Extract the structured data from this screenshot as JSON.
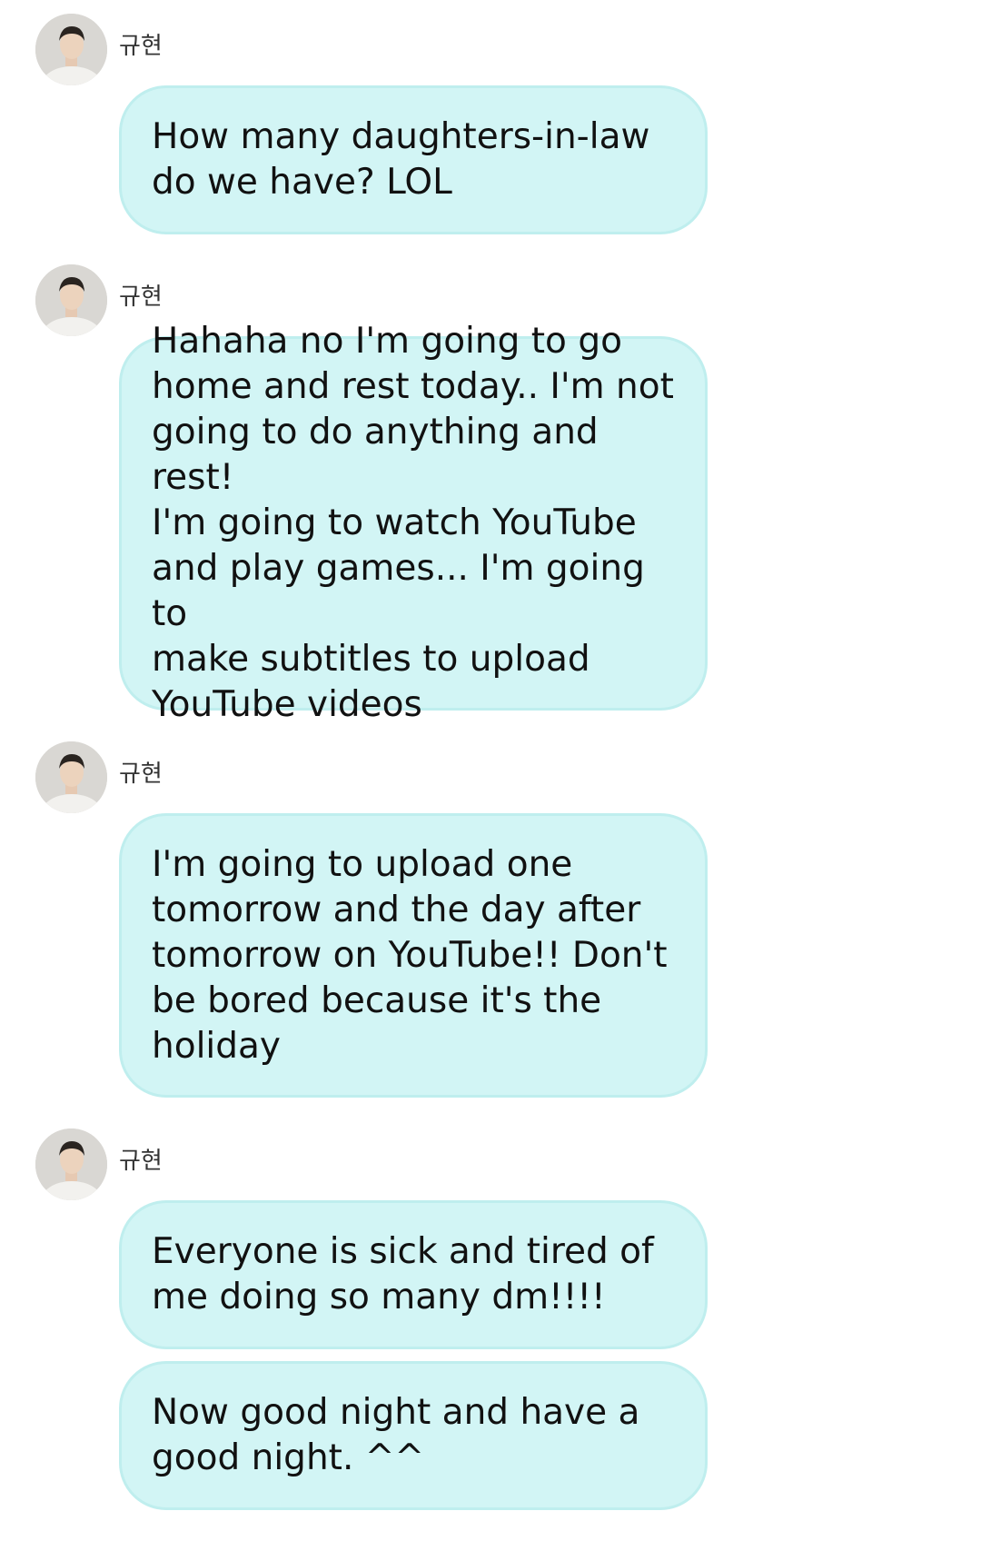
{
  "conversation": {
    "sender_name": "규현",
    "groups": [
      {
        "sender": "규현",
        "messages": [
          "How many daughters-in-law\ndo we have? LOL"
        ]
      },
      {
        "sender": "규현",
        "messages": [
          "Hahaha no I'm going to go\nhome and rest today.. I'm not\ngoing to do anything and rest!\nI'm going to watch YouTube\nand play games... I'm going to\nmake subtitles to upload\nYouTube videos"
        ]
      },
      {
        "sender": "규현",
        "messages": [
          "I'm going to upload one\ntomorrow and the day after\ntomorrow on YouTube!! Don't\nbe bored because it's the\nholiday"
        ]
      },
      {
        "sender": "규현",
        "messages": [
          "Everyone is sick and tired of\nme doing so many dm!!!!",
          "Now good night and have a\ngood night. ^^"
        ]
      }
    ]
  },
  "colors": {
    "bubble_fill": "#d2f5f5",
    "bubble_border": "#bfeeee",
    "text": "#111111",
    "sender_text": "#333333"
  }
}
